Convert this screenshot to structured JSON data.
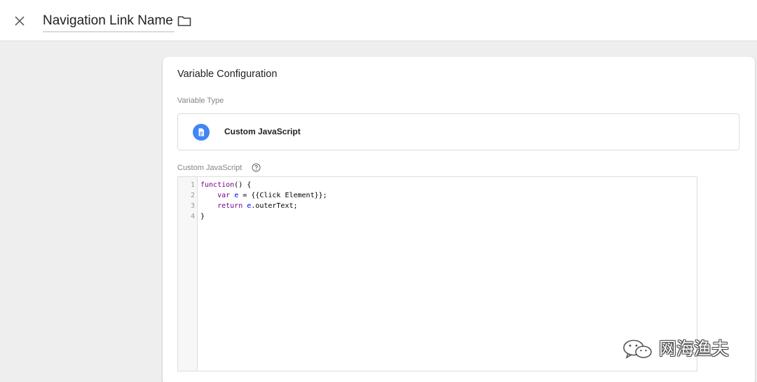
{
  "header": {
    "title": "Navigation Link Name",
    "close_icon": "close-icon",
    "folder_icon": "folder-icon"
  },
  "card": {
    "title": "Variable Configuration",
    "type_label": "Variable Type",
    "type_name": "Custom JavaScript",
    "type_icon": "document-icon",
    "js_label": "Custom JavaScript",
    "help_icon": "help-icon"
  },
  "editor": {
    "lines": [
      {
        "num": "1",
        "indent": "",
        "parts": [
          {
            "t": "function",
            "c": "kw"
          },
          {
            "t": "() {",
            "c": ""
          }
        ]
      },
      {
        "num": "2",
        "indent": "    ",
        "parts": [
          {
            "t": "var",
            "c": "kw"
          },
          {
            "t": " ",
            "c": ""
          },
          {
            "t": "e",
            "c": "var"
          },
          {
            "t": " = {{Click Element}};",
            "c": ""
          }
        ]
      },
      {
        "num": "3",
        "indent": "    ",
        "parts": [
          {
            "t": "return",
            "c": "kw"
          },
          {
            "t": " ",
            "c": ""
          },
          {
            "t": "e",
            "c": "var"
          },
          {
            "t": ".outerText;",
            "c": ""
          }
        ]
      },
      {
        "num": "4",
        "indent": "",
        "parts": [
          {
            "t": "}",
            "c": ""
          }
        ]
      }
    ]
  },
  "watermark": {
    "text": "网海渔夫",
    "icon": "wechat-icon"
  },
  "colors": {
    "accent": "#4285f4",
    "keyword": "#770088",
    "variable": "#0000ff"
  }
}
